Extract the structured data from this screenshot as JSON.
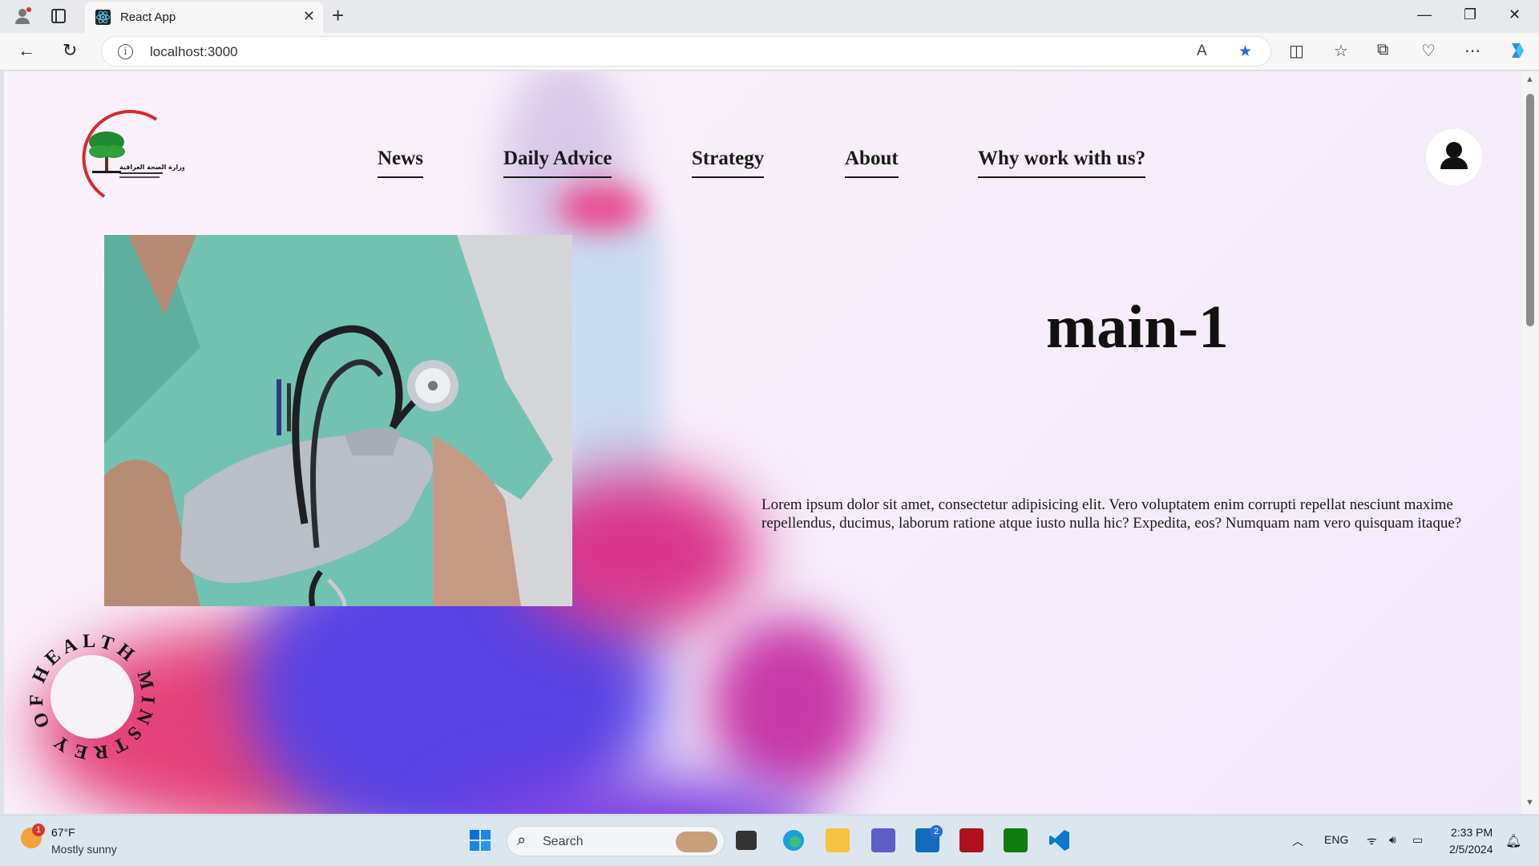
{
  "browser": {
    "tab_title": "React App",
    "url": "localhost:3000"
  },
  "site": {
    "nav": [
      "News",
      "Daily Advice",
      "Strategy",
      "About",
      "Why work with us?"
    ],
    "title": "main-1",
    "body_text": "Lorem ipsum dolor sit amet, consectetur adipisicing elit. Vero voluptatem enim corrupti repellat nesciunt maxime repellendus, ducimus, laborum ratione atque iusto nulla hic? Expedita, eos? Numquam nam vero quisquam itaque?",
    "stamp_text": "HEALTH MINSTREY OF",
    "logo_text": "وزارة الصحة العراقية"
  },
  "taskbar": {
    "weather_temp": "67°F",
    "weather_desc": "Mostly sunny",
    "weather_badge": "1",
    "search_label": "Search",
    "mail_badge": "2",
    "lang": "ENG",
    "time": "2:33 PM",
    "date": "2/5/2024"
  }
}
